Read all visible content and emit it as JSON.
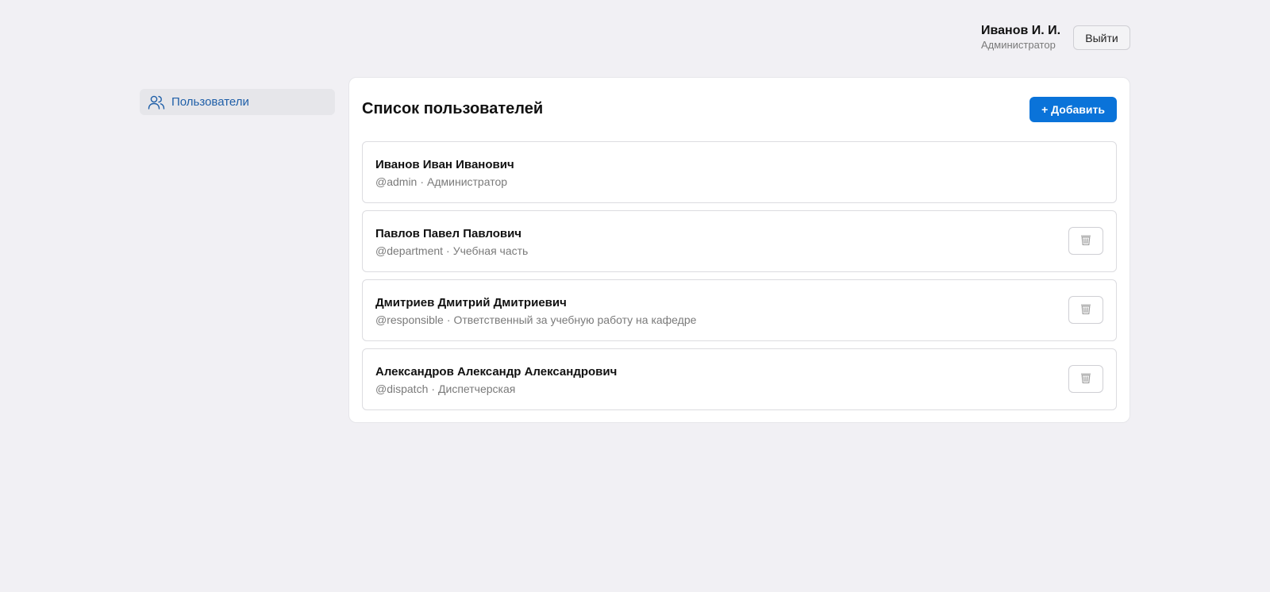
{
  "header": {
    "user_name": "Иванов И. И.",
    "user_role": "Администратор",
    "logout_label": "Выйти"
  },
  "sidebar": {
    "items": [
      {
        "label": "Пользователи",
        "icon": "users-icon",
        "active": true
      }
    ]
  },
  "main": {
    "title": "Список пользователей",
    "add_label": "+ Добавить",
    "users": [
      {
        "name": "Иванов Иван Иванович",
        "login": "@admin",
        "role": "Администратор",
        "deletable": false
      },
      {
        "name": "Павлов Павел Павлович",
        "login": "@department",
        "role": "Учебная часть",
        "deletable": true
      },
      {
        "name": "Дмитриев Дмитрий Дмитриевич",
        "login": "@responsible",
        "role": "Ответственный за учебную работу на кафедре",
        "deletable": true
      },
      {
        "name": "Александров Александр Александрович",
        "login": "@dispatch",
        "role": "Диспетчерская",
        "deletable": true
      }
    ],
    "separator": "·"
  },
  "colors": {
    "background": "#f1f0f4",
    "accent": "#0a73d9",
    "sidebar_active_text": "#1f5fa8",
    "muted_text": "#7a7a7a"
  }
}
